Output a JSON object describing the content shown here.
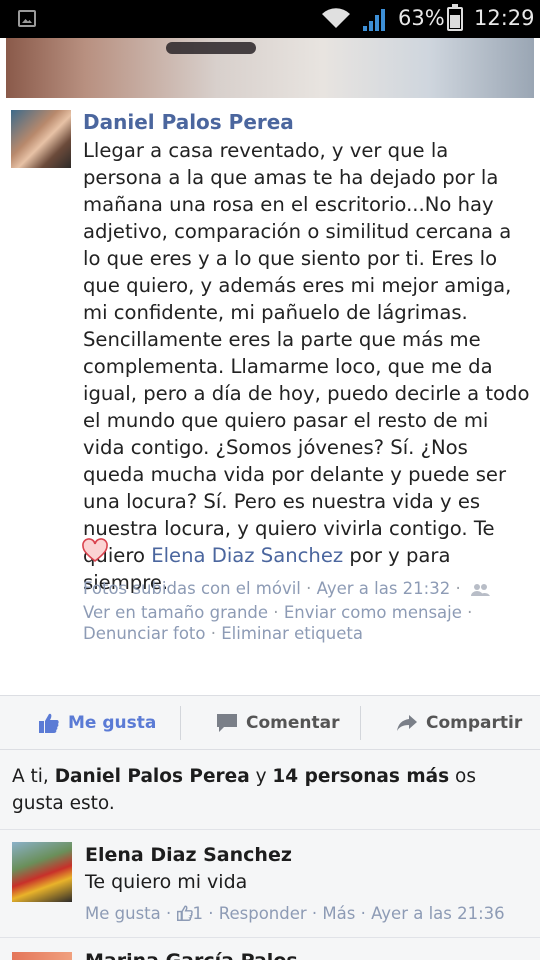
{
  "status_bar": {
    "battery_percent": "63%",
    "time": "12:29",
    "battery_level": 0.63,
    "icons": [
      "image-icon",
      "wifi-icon",
      "signal-icon",
      "battery-icon"
    ]
  },
  "post": {
    "author": "Daniel Palos Perea",
    "text_before_mention": "Llegar a casa reventado, y ver que la persona a la que amas te ha dejado por la mañana una rosa en el escritorio...No hay adjetivo, comparación o similitud cercana a lo que eres y a lo que siento por ti. Eres lo que quiero, y además eres mi mejor amiga, mi confidente, mi pañuelo de lágrimas. Sencillamente eres la parte que más me complementa. Llamarme loco, que me da igual, pero a día de hoy, puedo decirle a todo el mundo que quiero pasar el resto de mi vida contigo. ¿Somos jóvenes? Sí. ¿Nos queda mucha vida por delante y puede ser una locura? Sí. Pero es nuestra vida y es nuestra locura, y quiero vivirla contigo. Te quiero ",
    "mention": "Elena Diaz Sanchez",
    "text_after_mention": " por y para siempre.",
    "meta": {
      "uploaded_from": "Fotos subidas con el móvil",
      "time": "Ayer a las 21:32",
      "view_large": "Ver en tamaño grande",
      "send_message": "Enviar como mensaje",
      "report_photo": "Denunciar foto",
      "remove_tag": "Eliminar etiqueta"
    }
  },
  "actions": {
    "like": "Me gusta",
    "comment": "Comentar",
    "share": "Compartir"
  },
  "likes_summary": {
    "prefix": "A ti, ",
    "name": "Daniel Palos Perea",
    "middle": " y ",
    "count_text": "14 personas más",
    "suffix": " os gusta esto."
  },
  "comments": [
    {
      "author": "Elena Diaz Sanchez",
      "text": "Te quiero mi vida",
      "like": "Me gusta",
      "like_count": "1",
      "reply": "Responder",
      "more": "Más",
      "time": "Ayer a las 21:36"
    },
    {
      "author": "Marina García Palos"
    }
  ],
  "colors": {
    "link_blue": "#4b669e",
    "meta_blue": "#8d9bb5",
    "like_blue": "#5b7bd5",
    "background_gray": "#f5f6f7"
  }
}
